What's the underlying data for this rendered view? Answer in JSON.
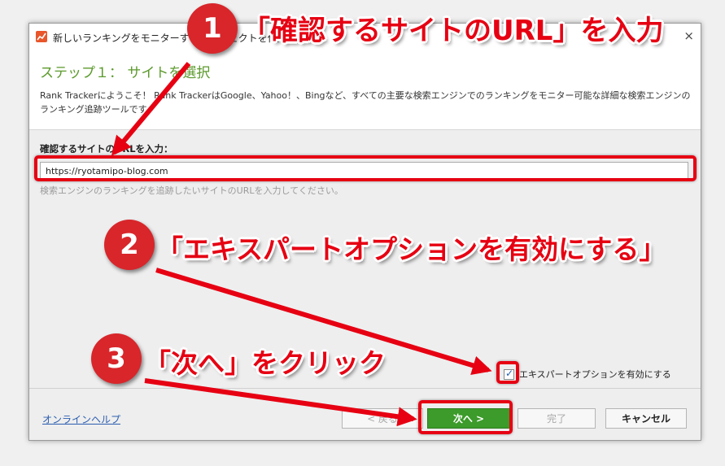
{
  "window": {
    "title": "新しいランキングをモニターするプロジェクトを作成する",
    "close_glyph": "×"
  },
  "header": {
    "step_title": "ステップ１： サイトを選択",
    "description": "Rank Trackerにようこそ！ Rank TrackerはGoogle、Yahoo！、Bingなど、すべての主要な検索エンジンでのランキングをモニター可能な詳細な検索エンジンのランキング追跡ツールです。"
  },
  "form": {
    "url_label": "確認するサイトのURLを入力：",
    "url_value": "https://ryotamipo-blog.com",
    "url_help": "検索エンジンのランキングを追跡したいサイトのURLを入力してください。",
    "expert_label": "エキスパートオプションを有効にする",
    "expert_checked": true,
    "check_glyph": "✓"
  },
  "footer": {
    "help_link": "オンラインヘルプ",
    "back_label": "< 戻る",
    "next_label": "次へ >",
    "finish_label": "完了",
    "cancel_label": "キャンセル"
  },
  "annotations": {
    "step1_num": "1",
    "step1_text": "「確認するサイトのURL」を入力",
    "step2_num": "2",
    "step2_text": "「エキスパートオプションを有効にする」",
    "step3_num": "3",
    "step3_text": "「次へ」をクリック",
    "color": "#e60012"
  },
  "colors": {
    "accent_green": "#5b9a2b",
    "next_button": "#3c9b2a",
    "link_blue": "#2a5db0",
    "badge_red": "#d8262b"
  }
}
